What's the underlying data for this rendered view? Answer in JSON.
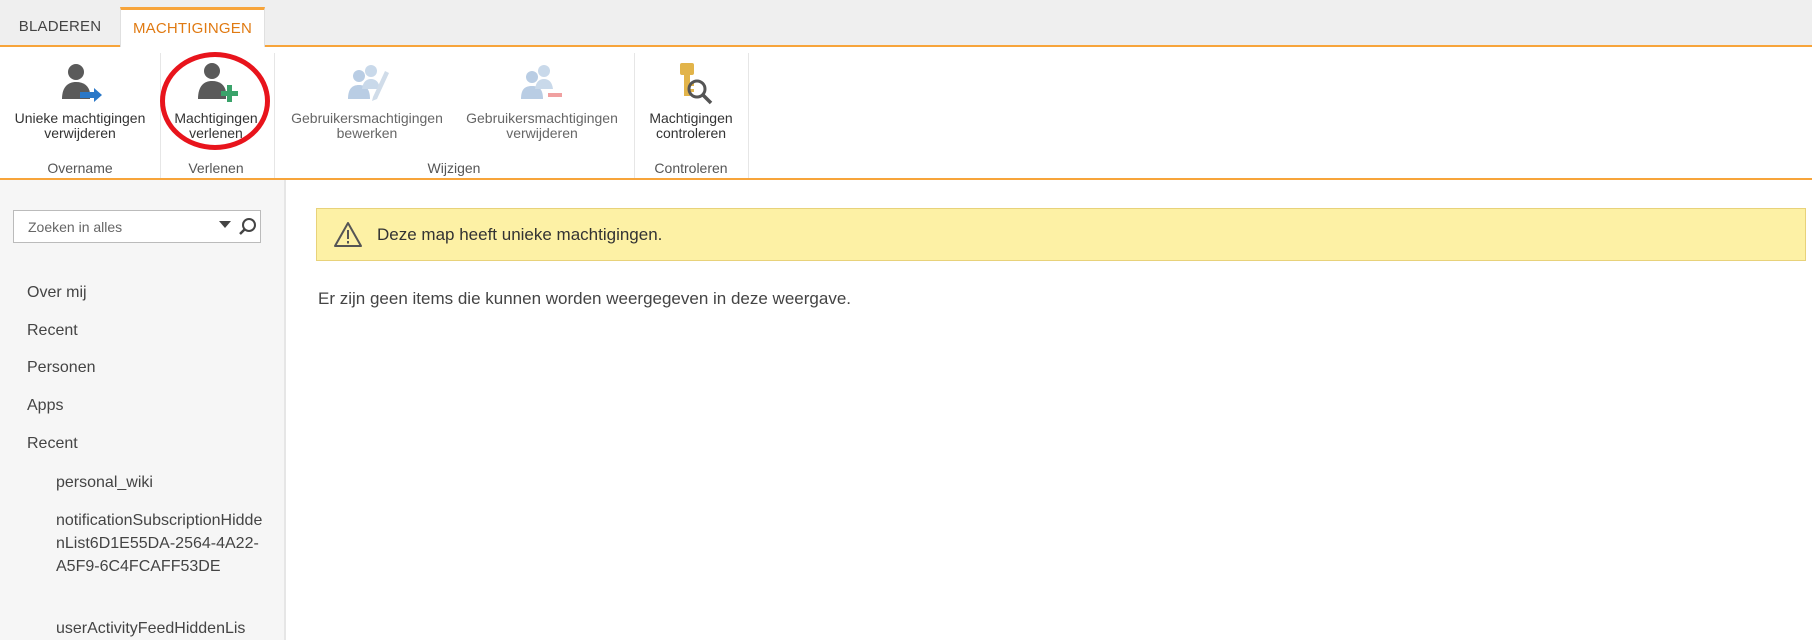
{
  "tabs": [
    {
      "label": "BLADEREN"
    },
    {
      "label": "MACHTIGINGEN"
    }
  ],
  "ribbon": {
    "buttons": [
      {
        "line1": "Unieke machtigingen",
        "line2": "verwijderen",
        "icon": "person-remove-arrow-icon"
      },
      {
        "line1": "Machtigingen",
        "line2": "verlenen",
        "icon": "person-add-icon"
      },
      {
        "line1": "Gebruikersmachtigingen",
        "line2": "bewerken",
        "icon": "users-edit-icon"
      },
      {
        "line1": "Gebruikersmachtigingen",
        "line2": "verwijderen",
        "icon": "users-remove-icon"
      },
      {
        "line1": "Machtigingen",
        "line2": "controleren",
        "icon": "key-search-icon"
      }
    ],
    "groups": [
      "Overname",
      "Verlenen",
      "Wijzigen",
      "Controleren"
    ]
  },
  "search": {
    "placeholder": "Zoeken in alles"
  },
  "nav": {
    "items": [
      "Over mij",
      "Recent",
      "Personen",
      "Apps",
      "Recent"
    ],
    "subitems": [
      "personal_wiki",
      "notificationSubscriptionHiddenList6D1E55DA-2564-4A22-A5F9-6C4FCAFF53DE",
      "userActivityFeedHiddenLis"
    ]
  },
  "banner": {
    "message": "Deze map heeft unieke machtigingen."
  },
  "main": {
    "empty_text": "Er zijn geen items die kunnen worden weergegeven in deze weergave."
  },
  "colors": {
    "accent": "#f7a43a",
    "highlight": "#e8141c",
    "banner_bg": "#fdf1a5"
  }
}
